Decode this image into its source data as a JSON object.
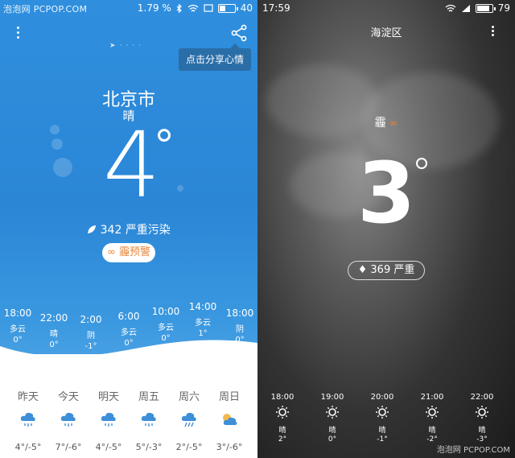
{
  "left": {
    "status": {
      "watermark": "泡泡网 PCPOP.COM",
      "battery_text": "1.79 %",
      "battery_level": "40"
    },
    "tooltip": "点击分享心情",
    "city": "北京市",
    "condition": "晴",
    "temperature": "4",
    "aqi_text": "342 严重污染",
    "warning": "∞ 霾预警",
    "hourly": [
      {
        "time": "18:00",
        "cond": "多云",
        "temp": "0°"
      },
      {
        "time": "22:00",
        "cond": "晴",
        "temp": "0°"
      },
      {
        "time": "2:00",
        "cond": "阴",
        "temp": "-1°"
      },
      {
        "time": "6:00",
        "cond": "多云",
        "temp": "0°"
      },
      {
        "time": "10:00",
        "cond": "多云",
        "temp": "0°"
      },
      {
        "time": "14:00",
        "cond": "多云",
        "temp": "1°"
      },
      {
        "time": "18:00",
        "cond": "阴",
        "temp": "0°"
      }
    ],
    "daily": [
      {
        "name": "昨天",
        "icon": "snow-cloud-icon",
        "range": "4°/-5°"
      },
      {
        "name": "今天",
        "icon": "snow-cloud-icon",
        "range": "7°/-6°"
      },
      {
        "name": "明天",
        "icon": "snow-cloud-icon",
        "range": "4°/-5°"
      },
      {
        "name": "周五",
        "icon": "snow-cloud-icon",
        "range": "5°/-3°"
      },
      {
        "name": "周六",
        "icon": "rain-cloud-icon",
        "range": "2°/-5°"
      },
      {
        "name": "周日",
        "icon": "partly-cloudy-icon",
        "range": "3°/-6°"
      }
    ]
  },
  "right": {
    "status": {
      "time": "17:59",
      "battery_level": "79"
    },
    "area": "海淀区",
    "haze": "霾",
    "haze_badge": "∞",
    "temperature": "3",
    "aqi_text": "♦ 369 严重",
    "hourly": [
      {
        "time": "18:00",
        "cond": "晴",
        "temp": "2°"
      },
      {
        "time": "19:00",
        "cond": "晴",
        "temp": "0°"
      },
      {
        "time": "20:00",
        "cond": "晴",
        "temp": "-1°"
      },
      {
        "time": "21:00",
        "cond": "晴",
        "temp": "-2°"
      },
      {
        "time": "22:00",
        "cond": "晴",
        "temp": "-3°"
      }
    ],
    "watermark": "泡泡网 PCPOP.COM"
  }
}
